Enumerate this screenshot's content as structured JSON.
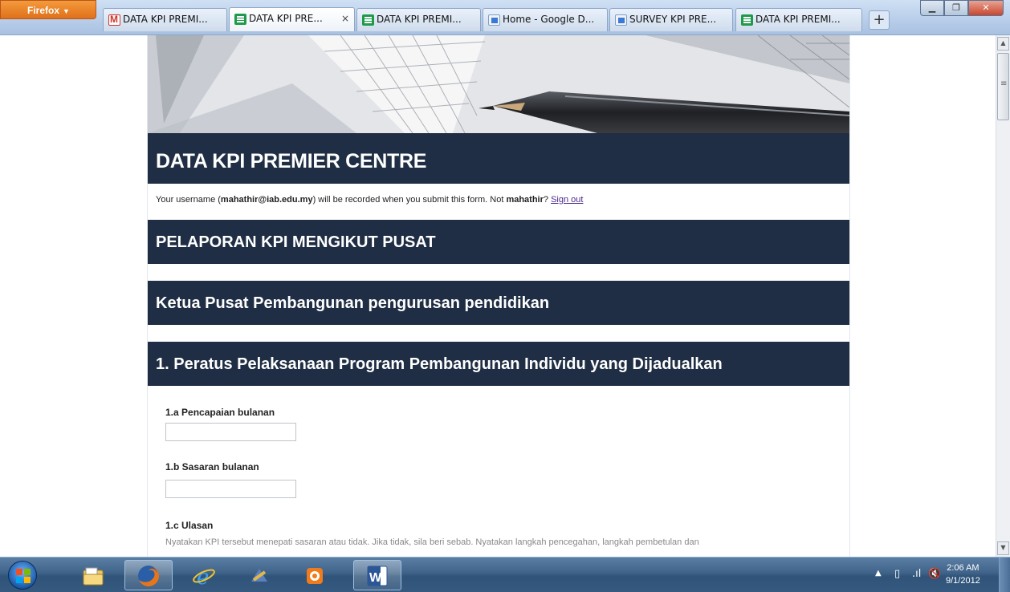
{
  "browser": {
    "menu_button": "Firefox",
    "tabs": [
      {
        "label": "DATA KPI PREMI...",
        "icon": "gmail-icon",
        "active": false
      },
      {
        "label": "DATA KPI PRE...",
        "icon": "sheets-icon",
        "active": true
      },
      {
        "label": "DATA KPI PREMI...",
        "icon": "sheets-icon",
        "active": false
      },
      {
        "label": "Home - Google D...",
        "icon": "drive-icon",
        "active": false
      },
      {
        "label": "SURVEY KPI PRE...",
        "icon": "drive-icon",
        "active": false
      },
      {
        "label": "DATA KPI PREMI...",
        "icon": "sheets-icon",
        "active": false
      }
    ],
    "new_tab": "+",
    "close_tab": "×"
  },
  "form": {
    "title": "DATA KPI PREMIER CENTRE",
    "user_notice": {
      "prefix": "Your username (",
      "email": "mahathir@iab.edu.my",
      "middle": ") will be recorded when you submit this form. Not ",
      "username": "mahathir",
      "suffix": "? ",
      "signout": "Sign out"
    },
    "section1": "PELAPORAN KPI MENGIKUT PUSAT",
    "section2": "Ketua Pusat Pembangunan pengurusan pendidikan",
    "section3": "1. Peratus Pelaksanaan Program Pembangunan Individu yang Dijadualkan",
    "questions": [
      {
        "label": "1.a Pencapaian bulanan",
        "value": ""
      },
      {
        "label": "1.b Sasaran bulanan",
        "value": ""
      },
      {
        "label": "1.c Ulasan",
        "help": "Nyatakan KPI tersebut menepati sasaran atau tidak. Jika tidak, sila beri sebab. Nyatakan langkah pencegahan, langkah pembetulan dan"
      }
    ]
  },
  "taskbar": {
    "apps": [
      "explorer-icon",
      "firefox-icon",
      "ie-icon",
      "media-center-icon",
      "vlc-icon",
      "word-icon"
    ],
    "clock_time": "2:06 AM",
    "clock_date": "9/1/2012"
  },
  "colors": {
    "header_bg": "#1f2e44",
    "link": "#4b2a8c",
    "firefox_orange": "#e0701a"
  }
}
